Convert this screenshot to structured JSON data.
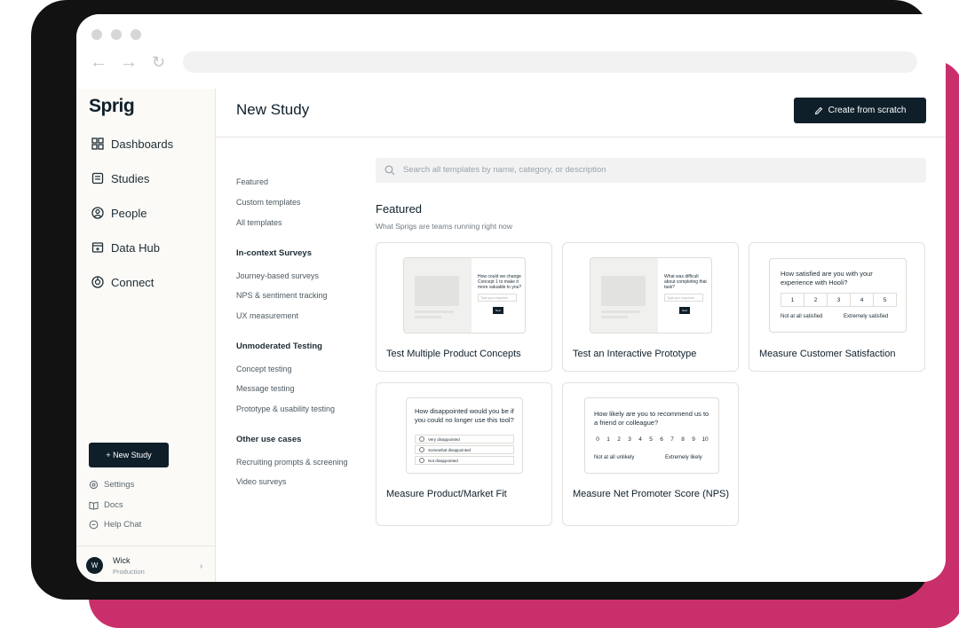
{
  "app": {
    "logo": "Sprig"
  },
  "sidebar": {
    "nav": [
      {
        "label": "Dashboards",
        "icon": "grid-icon"
      },
      {
        "label": "Studies",
        "icon": "document-icon"
      },
      {
        "label": "People",
        "icon": "user-circle-icon"
      },
      {
        "label": "Data Hub",
        "icon": "data-hub-icon"
      },
      {
        "label": "Connect",
        "icon": "connect-icon"
      }
    ],
    "new_study": "+ New Study",
    "links": [
      {
        "label": "Settings",
        "icon": "gear-icon"
      },
      {
        "label": "Docs",
        "icon": "book-icon"
      },
      {
        "label": "Help Chat",
        "icon": "chat-icon"
      }
    ],
    "user": {
      "initial": "W",
      "name": "Wick",
      "env": "Production"
    }
  },
  "header": {
    "title": "New Study",
    "create_button": "Create from scratch"
  },
  "categories": {
    "top": [
      "Featured",
      "Custom templates",
      "All templates"
    ],
    "groups": [
      {
        "title": "In-context Surveys",
        "items": [
          "Journey-based surveys",
          "NPS & sentiment tracking",
          "UX measurement"
        ]
      },
      {
        "title": "Unmoderated Testing",
        "items": [
          "Concept testing",
          "Message testing",
          "Prototype & usability testing"
        ]
      },
      {
        "title": "Other use cases",
        "items": [
          "Recruiting prompts & screening",
          "Video surveys"
        ]
      }
    ]
  },
  "search": {
    "placeholder": "Search all templates by name, category, or description"
  },
  "featured": {
    "title": "Featured",
    "subtitle": "What Sprigs are teams running right now"
  },
  "cards": [
    {
      "title": "Test Multiple Product Concepts",
      "preview_question": "How could we change Concept 1 to make it more valuable to you?",
      "preview_input": "Type your response",
      "preview_button": "Next"
    },
    {
      "title": "Test an Interactive Prototype",
      "preview_question": "What was difficult about completing that task?",
      "preview_input": "Type your response",
      "preview_button": "Next"
    },
    {
      "title": "Measure Customer Satisfaction",
      "preview_question": "How satisfied are you with your experience with Hooli?",
      "scale": [
        "1",
        "2",
        "3",
        "4",
        "5"
      ],
      "low_label": "Not at all satisfied",
      "high_label": "Extremely satisfied"
    },
    {
      "title": "Measure Product/Market Fit",
      "preview_question": "How disappointed would you be if you could no longer use this tool?",
      "options": [
        "Very disappointed",
        "Somewhat disappointed",
        "Not disappointed"
      ]
    },
    {
      "title": "Measure Net Promoter Score (NPS)",
      "preview_question": "How likely are you to recommend us to a friend or colleague?",
      "scale": [
        "0",
        "1",
        "2",
        "3",
        "4",
        "5",
        "6",
        "7",
        "8",
        "9",
        "10"
      ],
      "low_label": "Not at all unlikely",
      "high_label": "Extremely likely"
    }
  ]
}
